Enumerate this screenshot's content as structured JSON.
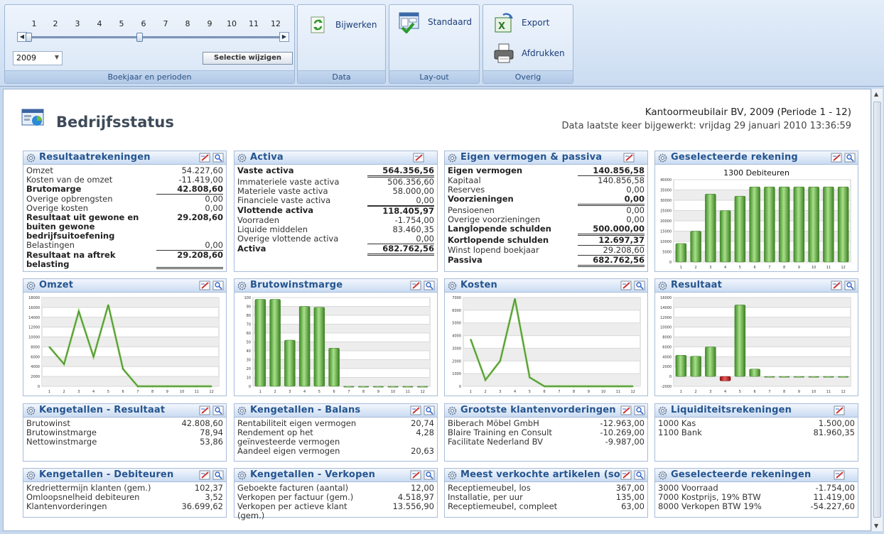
{
  "ribbon": {
    "periods": [
      "1",
      "2",
      "3",
      "4",
      "5",
      "6",
      "7",
      "8",
      "9",
      "10",
      "11",
      "12"
    ],
    "year": "2009",
    "selection_button": "Selectie wijzigen",
    "groups": {
      "boekjaar": "Boekjaar en perioden",
      "data": "Data",
      "layout": "Lay-out",
      "overig": "Overig"
    },
    "buttons": {
      "bijwerken": "Bijwerken",
      "standaard": "Standaard",
      "export": "Export",
      "afdrukken": "Afdrukken"
    }
  },
  "header": {
    "title": "Bedrijfsstatus",
    "company": "Kantoormeubilair BV, 2009 (Periode 1 - 12)",
    "updated": "Data laatste keer bijgewerkt: vrijdag 29 januari 2010 13:36:59"
  },
  "panels": {
    "resultaat": {
      "title": "Resultaatrekeningen",
      "rows": [
        {
          "label": "Omzet",
          "value": "54.227,60"
        },
        {
          "label": "Kosten van de omzet",
          "value": "-11.419,00"
        },
        {
          "label": "Brutomarge",
          "value": "42.808,60"
        },
        {
          "label": "Overige opbrengsten",
          "value": "0,00"
        },
        {
          "label": "Overige kosten",
          "value": "0,00"
        },
        {
          "label": "Resultaat uit gewone en buiten gewone bedrijfsuitoefening",
          "value": "29.208,60"
        },
        {
          "label": "Belastingen",
          "value": "0,00"
        },
        {
          "label": "Resultaat na aftrek belasting",
          "value": "29.208,60"
        }
      ]
    },
    "activa": {
      "title": "Activa",
      "rows": [
        {
          "label": "Vaste activa",
          "value": "564.356,56"
        },
        {
          "label": "Immateriele vaste activa",
          "value": "506.356,60"
        },
        {
          "label": "Materiele vaste activa",
          "value": "58.000,00"
        },
        {
          "label": "Financiele vaste activa",
          "value": "0,00"
        },
        {
          "label": "Vlottende activa",
          "value": "118.405,97"
        },
        {
          "label": "Voorraden",
          "value": "-1.754,00"
        },
        {
          "label": "Liquide middelen",
          "value": "83.460,35"
        },
        {
          "label": "Overige vlottende activa",
          "value": "0,00"
        },
        {
          "label": "Activa",
          "value": "682.762,56"
        }
      ]
    },
    "passiva": {
      "title": "Eigen vermogen & passiva",
      "rows": [
        {
          "label": "Eigen vermogen",
          "value": "140.856,58"
        },
        {
          "label": "Kapitaal",
          "value": "140.856,58"
        },
        {
          "label": "Reserves",
          "value": "0,00"
        },
        {
          "label": "Voorzieningen",
          "value": "0,00"
        },
        {
          "label": "Pensioenen",
          "value": "0,00"
        },
        {
          "label": "Overige voorzieningen",
          "value": "0,00"
        },
        {
          "label": "Langlopende schulden",
          "value": "500.000,00"
        },
        {
          "label": "Kortlopende schulden",
          "value": "12.697,37"
        },
        {
          "label": "Winst lopend boekjaar",
          "value": "29.208,60"
        },
        {
          "label": "Passiva",
          "value": "682.762,56"
        }
      ]
    },
    "geselecteerd": {
      "title": "Geselecteerde rekening"
    },
    "omzet": {
      "title": "Omzet"
    },
    "bruto": {
      "title": "Brutowinstmarge"
    },
    "kosten": {
      "title": "Kosten"
    },
    "resultaat_chart": {
      "title": "Resultaat"
    },
    "kg_resultaat": {
      "title": "Kengetallen - Resultaat",
      "rows": [
        {
          "label": "Brutowinst",
          "value": "42.808,60"
        },
        {
          "label": "Brutowinstmarge",
          "value": "78,94"
        },
        {
          "label": "Nettowinstmarge",
          "value": "53,86"
        }
      ]
    },
    "kg_balans": {
      "title": "Kengetallen - Balans",
      "rows": [
        {
          "label": "Rentabiliteit eigen vermogen",
          "value": "20,74"
        },
        {
          "label": "Rendement op het geïnvesteerde vermogen",
          "value": "4,28"
        },
        {
          "label": "Aandeel eigen vermogen",
          "value": "20,63"
        }
      ]
    },
    "klanten": {
      "title": "Grootste klantenvorderingen",
      "rows": [
        {
          "label": "Biberach Möbel GmbH",
          "value": "-12.963,00"
        },
        {
          "label": "Blaire Training en Consult",
          "value": "-10.269,00"
        },
        {
          "label": "Facilitate Nederland BV",
          "value": "-9.987,00"
        }
      ]
    },
    "liquiditeit": {
      "title": "Liquiditeitsrekeningen",
      "rows": [
        {
          "label": "1000 Kas",
          "value": "1.500,00"
        },
        {
          "label": "1100 Bank",
          "value": "81.960,35"
        }
      ]
    },
    "kg_debiteuren": {
      "title": "Kengetallen - Debiteuren",
      "rows": [
        {
          "label": "Kredriettermijn klanten (gem.)",
          "value": "102,37"
        },
        {
          "label": "Omloopsnelheid debiteuren",
          "value": "3,52"
        },
        {
          "label": "Klantenvorderingen",
          "value": "36.699,62"
        }
      ]
    },
    "kg_verkopen": {
      "title": "Kengetallen - Verkopen",
      "rows": [
        {
          "label": "Geboekte facturen (aantal)",
          "value": "12,00"
        },
        {
          "label": "Verkopen per factuur (gem.)",
          "value": "4.518,97"
        },
        {
          "label": "Verkopen per actieve klant (gem.)",
          "value": "13.556,90"
        }
      ]
    },
    "artikelen": {
      "title": "Meest verkochte artikelen (sor",
      "rows": [
        {
          "label": "Receptiemeubel, los",
          "value": "367,00"
        },
        {
          "label": "Installatie, per uur",
          "value": "135,00"
        },
        {
          "label": "Receptiemeubel, compleet",
          "value": "63,00"
        }
      ]
    },
    "rekeningen": {
      "title": "Geselecteerde rekeningen",
      "rows": [
        {
          "label": "3000 Voorraad",
          "value": "-1.754,00"
        },
        {
          "label": "7000 Kostprijs, 19% BTW",
          "value": "11.419,00"
        },
        {
          "label": "8000 Verkopen BTW 19%",
          "value": "-54.227,60"
        }
      ]
    }
  },
  "chart_data": [
    {
      "id": "geselecteerd",
      "type": "bar",
      "title": "1300 Debiteuren",
      "categories": [
        "1",
        "2",
        "3",
        "4",
        "5",
        "6",
        "7",
        "8",
        "9",
        "10",
        "11",
        "12"
      ],
      "values": [
        9000,
        15000,
        33000,
        25000,
        32000,
        36500,
        36500,
        36500,
        36500,
        36500,
        36500,
        36500
      ],
      "ylim": [
        0,
        40000
      ],
      "yticks": [
        "0",
        "5000",
        "10000",
        "15000",
        "20000",
        "25000",
        "30000",
        "35000",
        "40000"
      ],
      "color": "#5faa3c"
    },
    {
      "id": "omzet",
      "type": "line",
      "categories": [
        "1",
        "2",
        "3",
        "4",
        "5",
        "6",
        "7",
        "8",
        "9",
        "10",
        "11",
        "12"
      ],
      "values": [
        8000,
        4500,
        15200,
        6000,
        16500,
        3500,
        0,
        0,
        0,
        0,
        0,
        0
      ],
      "ylim": [
        0,
        18000
      ],
      "yticks": [
        "0",
        "2000",
        "4000",
        "6000",
        "8000",
        "10000",
        "12000",
        "14000",
        "16000",
        "18000"
      ],
      "color": "#5faa3c"
    },
    {
      "id": "bruto",
      "type": "bar",
      "categories": [
        "1",
        "2",
        "3",
        "4",
        "5",
        "6",
        "7",
        "8",
        "9",
        "10",
        "11",
        "12"
      ],
      "values": [
        98,
        98,
        52,
        90,
        89,
        43,
        0,
        0,
        0,
        0,
        0,
        0
      ],
      "ylim": [
        0,
        100
      ],
      "yticks": [
        "0",
        "10",
        "20",
        "30",
        "40",
        "50",
        "60",
        "70",
        "80",
        "90",
        "100"
      ],
      "color": "#5faa3c"
    },
    {
      "id": "kosten",
      "type": "line",
      "categories": [
        "1",
        "2",
        "3",
        "4",
        "5",
        "6",
        "7",
        "8",
        "9",
        "10",
        "11",
        "12"
      ],
      "values": [
        3700,
        500,
        2000,
        6900,
        700,
        0,
        0,
        0,
        0,
        0,
        0,
        0
      ],
      "ylim": [
        0,
        7000
      ],
      "yticks": [
        "0",
        "1000",
        "2000",
        "3000",
        "4000",
        "5000",
        "6000",
        "7000"
      ],
      "color": "#5faa3c"
    },
    {
      "id": "resultaat_chart",
      "type": "bar",
      "categories": [
        "1",
        "2",
        "3",
        "4",
        "5",
        "6",
        "7",
        "8",
        "9",
        "10",
        "11",
        "12"
      ],
      "values": [
        4300,
        4100,
        6000,
        -900,
        14500,
        1500,
        0,
        0,
        0,
        0,
        0,
        0
      ],
      "ylim": [
        -2000,
        16000
      ],
      "yticks": [
        "-2000",
        "0",
        "2000",
        "4000",
        "6000",
        "8000",
        "10000",
        "12000",
        "14000",
        "16000"
      ],
      "color": "#5faa3c",
      "neg_color": "#cc2222"
    }
  ]
}
